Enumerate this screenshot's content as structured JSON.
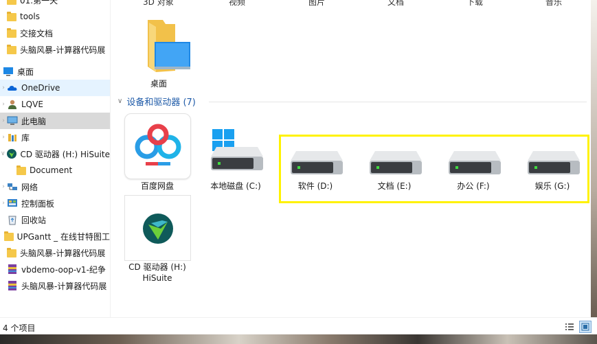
{
  "sidebar": {
    "items": [
      {
        "label": "01.第一天",
        "icon": "folder-icon",
        "name": "sidebar-item-day1"
      },
      {
        "label": "tools",
        "icon": "folder-icon",
        "name": "sidebar-item-tools"
      },
      {
        "label": "交接文档",
        "icon": "folder-icon",
        "name": "sidebar-item-handover"
      },
      {
        "label": "头脑风暴-计算器代码展",
        "icon": "folder-icon",
        "name": "sidebar-item-brainstorm"
      },
      {
        "label": "桌面",
        "icon": "desktop-icon",
        "name": "sidebar-item-desktop"
      },
      {
        "label": "OneDrive",
        "icon": "cloud-icon",
        "name": "sidebar-item-onedrive"
      },
      {
        "label": "LQVE",
        "icon": "user-icon",
        "name": "sidebar-item-user"
      },
      {
        "label": "此电脑",
        "icon": "computer-icon",
        "name": "sidebar-item-this-pc"
      },
      {
        "label": "库",
        "icon": "library-icon",
        "name": "sidebar-item-library"
      },
      {
        "label": "CD 驱动器 (H:) HiSuite",
        "icon": "hisuite-icon",
        "name": "sidebar-item-cd-drive"
      },
      {
        "label": "Document",
        "icon": "folder-icon",
        "name": "sidebar-item-document"
      },
      {
        "label": "网络",
        "icon": "network-icon",
        "name": "sidebar-item-network"
      },
      {
        "label": "控制面板",
        "icon": "control-panel-icon",
        "name": "sidebar-item-control-panel"
      },
      {
        "label": "回收站",
        "icon": "recycle-bin-icon",
        "name": "sidebar-item-recycle-bin"
      },
      {
        "label": "UPGantt _ 在线甘特图工",
        "icon": "folder-icon",
        "name": "sidebar-item-upgantt"
      },
      {
        "label": "头脑风暴-计算器代码展",
        "icon": "folder-icon",
        "name": "sidebar-item-brainstorm-2"
      },
      {
        "label": "vbdemo-oop-v1-纪争",
        "icon": "archive-icon",
        "name": "sidebar-item-vbdemo"
      },
      {
        "label": "头脑风暴-计算器代码展",
        "icon": "archive-icon",
        "name": "sidebar-item-brainstorm-zip"
      }
    ]
  },
  "folders_row": {
    "labels": [
      "3D 对象",
      "视频",
      "图片",
      "文档",
      "下载",
      "音乐"
    ]
  },
  "desktop_folder": {
    "label": "桌面"
  },
  "section": {
    "title": "设备和驱动器 (7)"
  },
  "drives": [
    {
      "label": "百度网盘",
      "icon": "baidu-netdisk-icon"
    },
    {
      "label": "本地磁盘 (C:)",
      "icon": "windows-drive-icon"
    },
    {
      "label": "软件 (D:)",
      "icon": "hard-drive-icon"
    },
    {
      "label": "文档 (E:)",
      "icon": "hard-drive-icon"
    },
    {
      "label": "办公 (F:)",
      "icon": "hard-drive-icon"
    },
    {
      "label": "娱乐 (G:)",
      "icon": "hard-drive-icon"
    }
  ],
  "cd_drive": {
    "label_line1": "CD 驱动器 (H:)",
    "label_line2": "HiSuite",
    "icon": "hisuite-icon"
  },
  "status": {
    "count": "4 个项目"
  },
  "colors": {
    "highlight": "#fff200",
    "accent": "#1e5aa8",
    "hover": "#e5f3ff",
    "selected": "#d9d9d9"
  }
}
